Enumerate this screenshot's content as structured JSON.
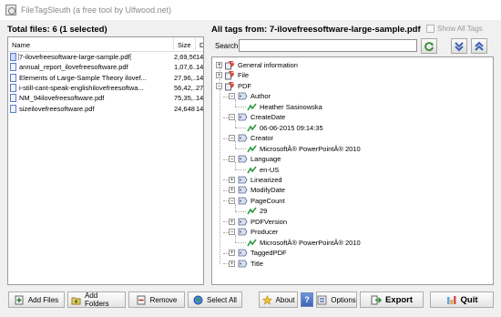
{
  "window": {
    "title": "FileTagSleuth (a free tool by Ulfwood.net)"
  },
  "left": {
    "header": "Total files: 6 (1 selected)",
    "columns": {
      "name": "Name",
      "size": "Size",
      "d": "Da"
    },
    "files": [
      {
        "name": "7-ilovefreesoftware-large-sample.pdf",
        "size": "2,69,560",
        "d": "14",
        "selected": true
      },
      {
        "name": "annual_report_ilovefreesoftware.pdf",
        "size": "1,07,6...",
        "d": "14"
      },
      {
        "name": "Elements of Large-Sample Theory ilovef...",
        "size": "27,96,...",
        "d": "14"
      },
      {
        "name": "i-still-cant-speak-englishilovefreesoftwa...",
        "size": "56,42,...",
        "d": "27"
      },
      {
        "name": "NM_94ilovefreesoftware.pdf",
        "size": "75,35,...",
        "d": "14"
      },
      {
        "name": "sizeilovefreesoftware.pdf",
        "size": "24,648",
        "d": "14"
      }
    ]
  },
  "right": {
    "header": "All tags from: 7-ilovefreesoftware-large-sample.pdf",
    "show_all_label": "Show All Tags",
    "search_label": "Search",
    "search_value": "",
    "tree": {
      "general": "General information",
      "file": "File",
      "pdf": "PDF",
      "tags": [
        {
          "name": "Author",
          "value": "Heather Sasinowska"
        },
        {
          "name": "CreateDate",
          "value": "06-06-2015 09:14:35"
        },
        {
          "name": "Creator",
          "value": "MicrosoftÂ® PowerPointÂ® 2010"
        },
        {
          "name": "Language",
          "value": "en-US"
        },
        {
          "name": "Linearized",
          "value": null
        },
        {
          "name": "ModifyDate",
          "value": null
        },
        {
          "name": "PageCount",
          "value": "29"
        },
        {
          "name": "PDFVersion",
          "value": null
        },
        {
          "name": "Producer",
          "value": "MicrosoftÂ® PowerPointÂ® 2010"
        },
        {
          "name": "TaggedPDF",
          "value": null
        },
        {
          "name": "Title",
          "value": null
        }
      ]
    }
  },
  "toolbar": {
    "add_files": "Add Files",
    "add_folders": "Add Folders",
    "remove": "Remove",
    "select_all": "Select All",
    "about": "About",
    "help": "?",
    "options": "Options",
    "export": "Export",
    "quit": "Quit"
  }
}
